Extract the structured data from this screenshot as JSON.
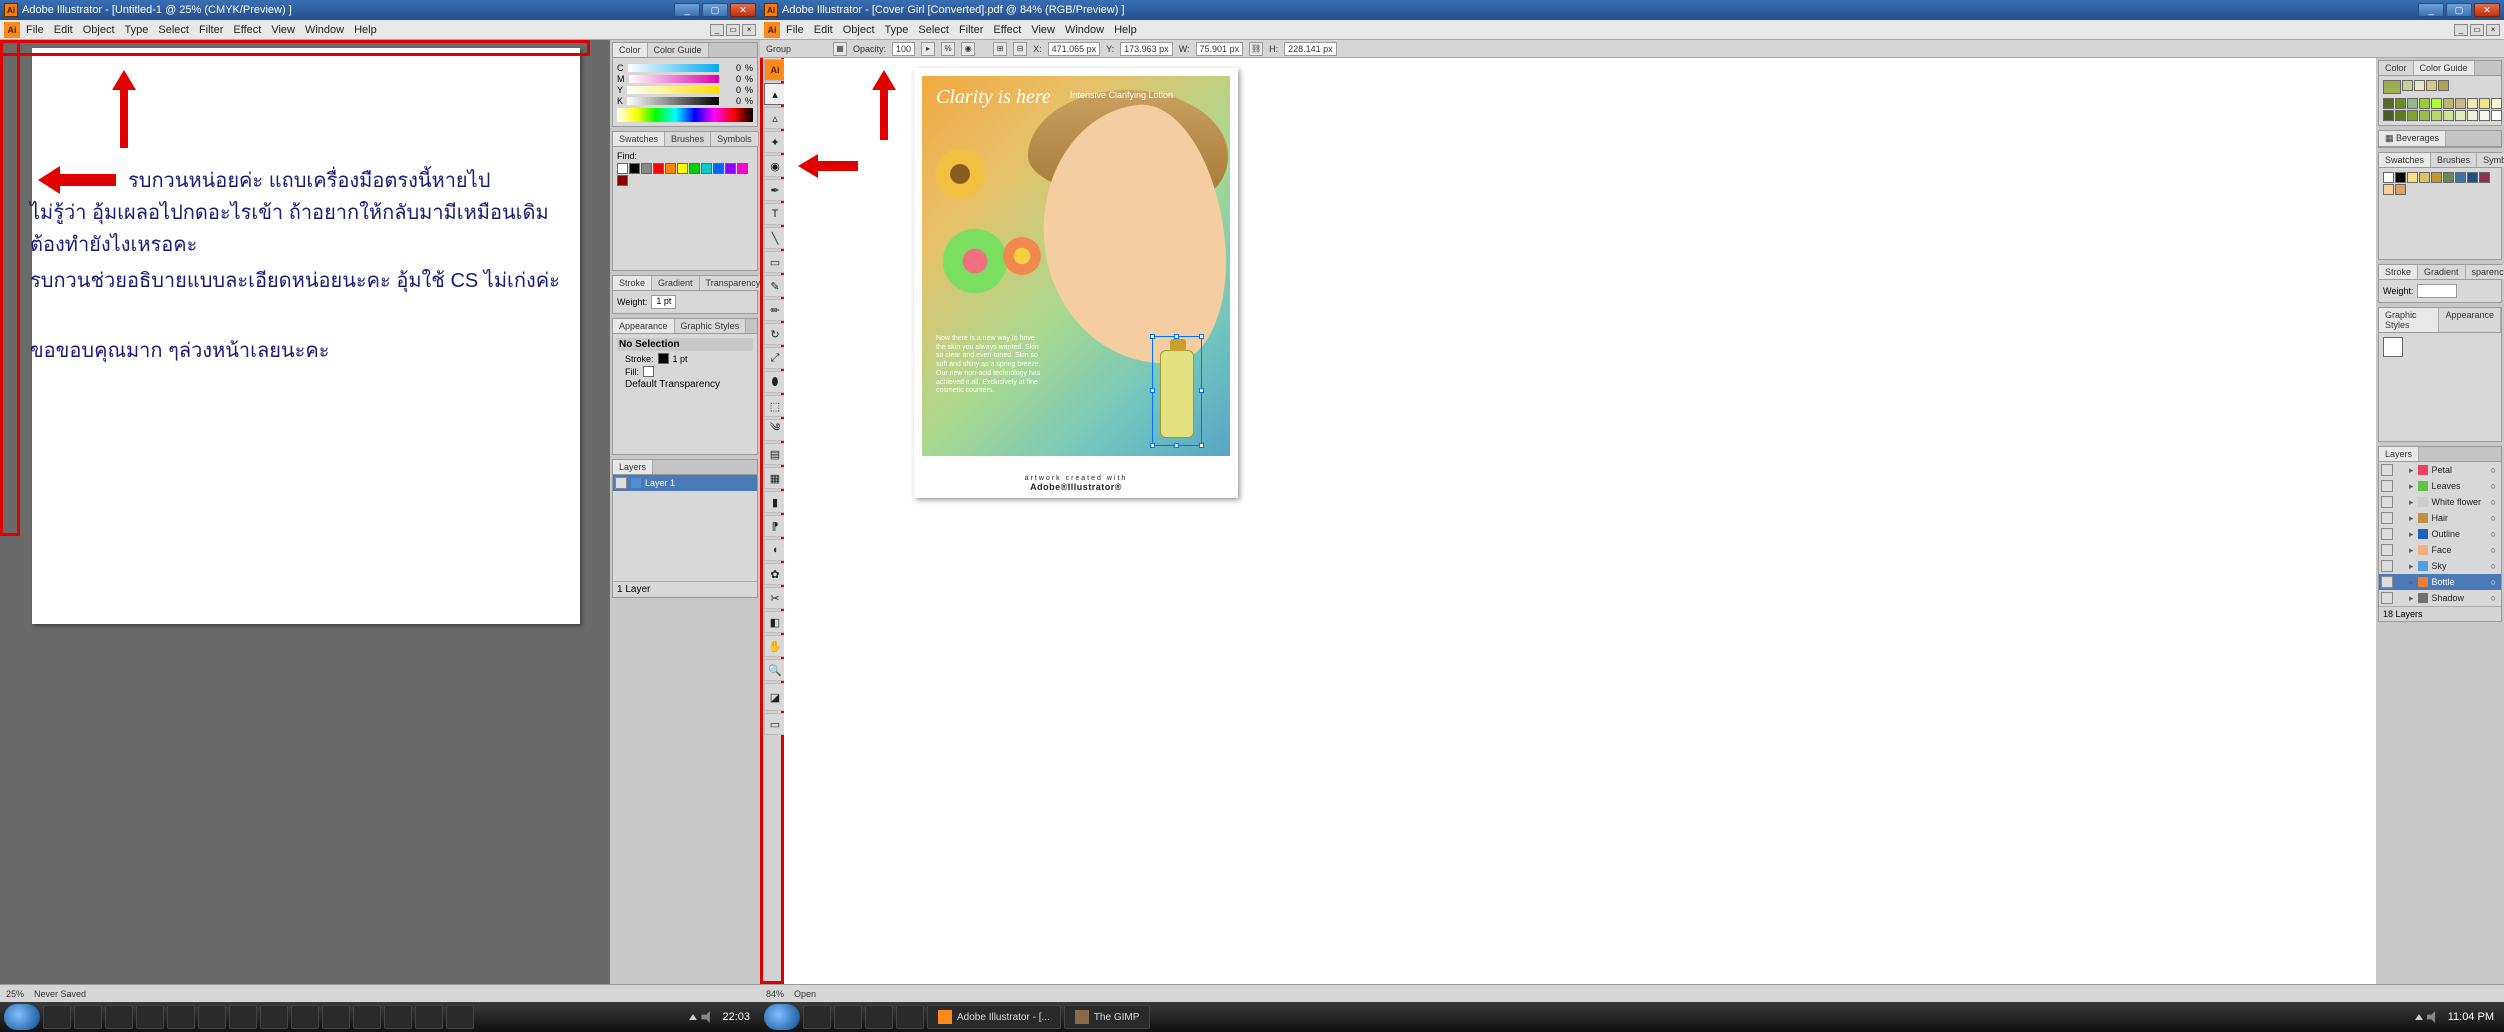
{
  "left": {
    "title": "Adobe Illustrator - [Untitled-1 @ 25% (CMYK/Preview) ]",
    "menus": [
      "File",
      "Edit",
      "Object",
      "Type",
      "Select",
      "Filter",
      "Effect",
      "View",
      "Window",
      "Help"
    ],
    "annot": {
      "l1": "รบกวนหน่อยค่ะ   แถบเครื่องมือตรงนี้หายไป",
      "l2": "ไม่รู้ว่า อุ้มเผลอไปกดอะไรเข้า   ถ้าอยากให้กลับมามีเหมือนเดิม",
      "l3": "ต้องทำยังไงเหรอคะ",
      "l4": "รบกวนช่วยอธิบายแบบละเอียดหน่อยนะคะ   อุ้มใช้ CS ไม่เก่งค่ะ",
      "l5": "ขอขอบคุณมาก ๆล่วงหน้าเลยนะคะ"
    },
    "panels": {
      "color_tabs": [
        "Color",
        "Color Guide"
      ],
      "cmyk": [
        {
          "ch": "C",
          "v": "0"
        },
        {
          "ch": "M",
          "v": "0"
        },
        {
          "ch": "Y",
          "v": "0"
        },
        {
          "ch": "K",
          "v": "0"
        }
      ],
      "pct": "%",
      "swatch_tabs": [
        "Swatches",
        "Brushes",
        "Symbols"
      ],
      "find": "Find:",
      "stroke_tabs": [
        "Stroke",
        "Gradient",
        "Transparency"
      ],
      "weight": "Weight:",
      "weight_val": "1 pt",
      "appear_tabs": [
        "Appearance",
        "Graphic Styles"
      ],
      "no_sel": "No Selection",
      "stroke_lbl": "Stroke:",
      "stroke_val": "1 pt",
      "fill_lbl": "Fill:",
      "def_trans": "Default Transparency",
      "layers_tab": "Layers",
      "layer1": "Layer 1",
      "layer_count": "1 Layer"
    },
    "status": {
      "zoom": "25%",
      "doc": "Never Saved"
    },
    "taskbar_time": "22:03"
  },
  "right": {
    "title": "Adobe Illustrator - [Cover Girl [Converted].pdf @ 84% (RGB/Preview) ]",
    "menus": [
      "File",
      "Edit",
      "Object",
      "Type",
      "Select",
      "Filter",
      "Effect",
      "View",
      "Window",
      "Help"
    ],
    "optbar": {
      "sel": "Group",
      "opacity_lbl": "Opacity:",
      "opacity": "100",
      "x_lbl": "X:",
      "x": "471.065 px",
      "y_lbl": "Y:",
      "y": "173.963 px",
      "w_lbl": "W:",
      "w": "75.901 px",
      "h_lbl": "H:",
      "h": "228.141 px"
    },
    "art": {
      "title": "Clarity is here",
      "sub": "Intensive Clarifying Lotion",
      "copy": "Now there is a new way to have the skin you always wanted. Skin so clear and even-toned. Skin so soft and shiny as a spring breeze. Our new non-acid technology has achieved it all. Exclusively at fine cosmetic counters.",
      "credit_top": "artwork created with",
      "credit": "Adobe®Illustrator®"
    },
    "panels": {
      "color_tabs": [
        "Color",
        "Color Guide"
      ],
      "bev": "Beverages",
      "swatch_tabs": [
        "Swatches",
        "Brushes",
        "Symbols"
      ],
      "stroke_tabs": [
        "Stroke",
        "Gradient",
        "sparency"
      ],
      "weight": "Weight:",
      "gs_tabs": [
        "Graphic Styles",
        "Appearance"
      ],
      "layers_tab": "Layers",
      "layers": [
        {
          "name": "Petal",
          "c": "#f04060"
        },
        {
          "name": "Leaves",
          "c": "#60c050"
        },
        {
          "name": "White flower",
          "c": "#cccccc"
        },
        {
          "name": "Hair",
          "c": "#c09040"
        },
        {
          "name": "Outline",
          "c": "#2060c0"
        },
        {
          "name": "Face",
          "c": "#f0b080"
        },
        {
          "name": "Sky",
          "c": "#50a0e0"
        },
        {
          "name": "Bottle",
          "c": "#f08030"
        },
        {
          "name": "Shadow",
          "c": "#707070"
        }
      ],
      "layer_count": "18 Layers"
    },
    "status": {
      "zoom": "84%",
      "doc": "Open"
    },
    "taskbar": {
      "app1": "Adobe Illustrator - [...",
      "app2": "The GIMP",
      "time": "11:04 PM"
    }
  }
}
